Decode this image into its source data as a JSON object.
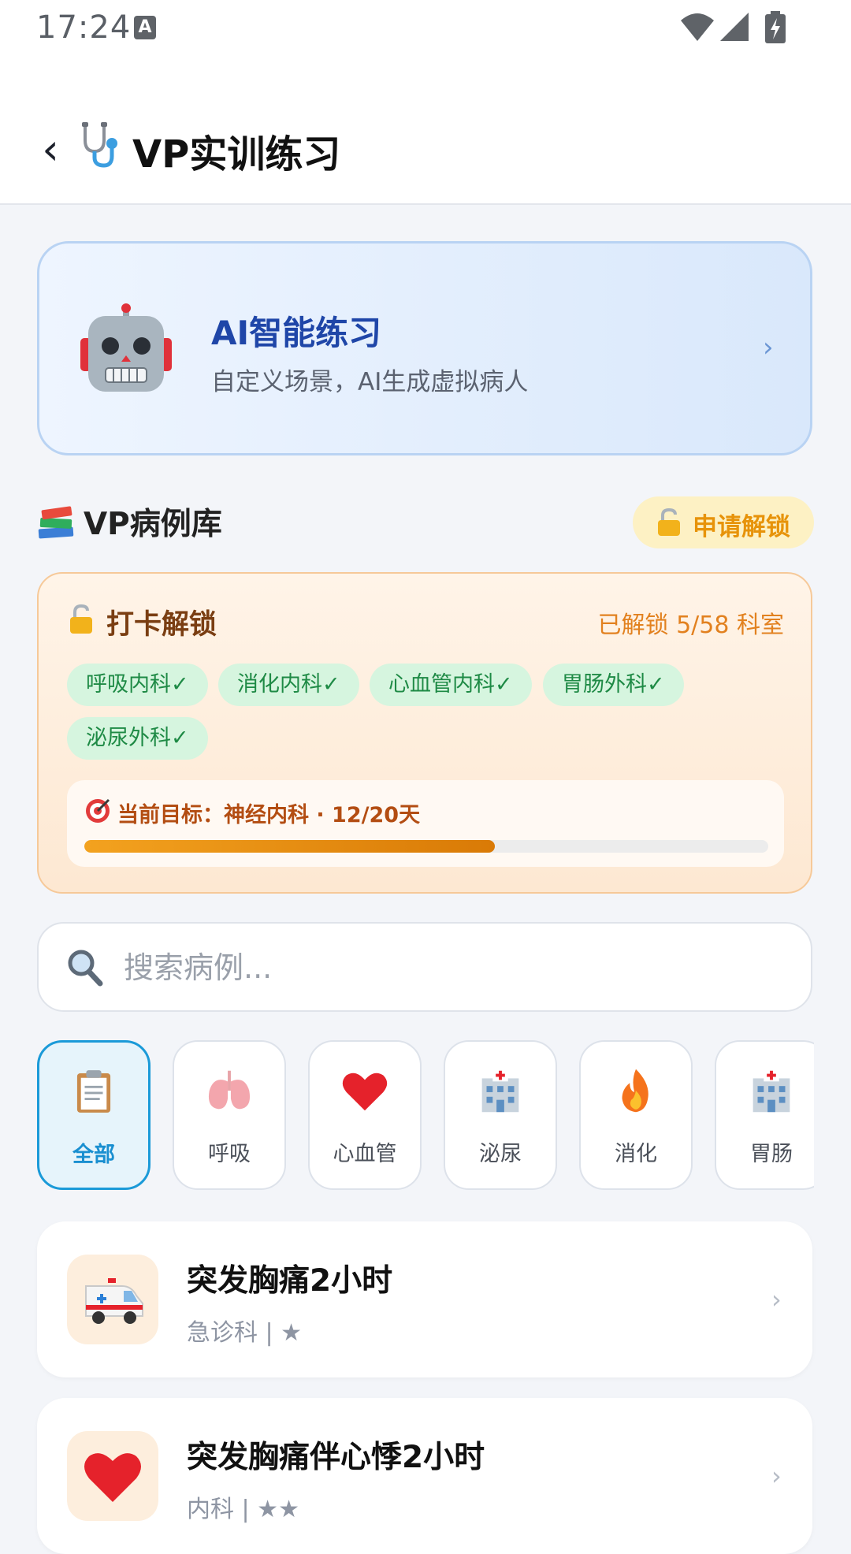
{
  "status_bar": {
    "time": "17:24",
    "notification_icon_label": "A"
  },
  "header": {
    "back_label": "‹",
    "title": "VP实训练习",
    "title_icon": "stethoscope-icon"
  },
  "ai_card": {
    "title": "AI智能练习",
    "subtitle": "自定义场景，AI生成虚拟病人",
    "icon": "robot-icon",
    "chevron": "›"
  },
  "library": {
    "title": "VP病例库",
    "icon": "books-icon",
    "unlock_request_label": "申请解锁"
  },
  "checkin": {
    "title": "打卡解锁",
    "unlocked_status": "已解锁 5/58 科室",
    "unlocked_departments": [
      "呼吸内科✓",
      "消化内科✓",
      "心血管内科✓",
      "胃肠外科✓",
      "泌尿外科✓"
    ],
    "goal_text": "当前目标：神经内科 · 12/20天",
    "goal_progress": 0.6,
    "colors": {
      "progress_start": "#f3a21f",
      "progress_end": "#d97a06",
      "chip_bg": "#d6f5df",
      "chip_text": "#1e8a45"
    }
  },
  "search": {
    "placeholder": "搜索病例..."
  },
  "categories": [
    {
      "label": "全部",
      "icon": "clipboard-icon",
      "active": true
    },
    {
      "label": "呼吸",
      "icon": "lungs-icon",
      "active": false
    },
    {
      "label": "心血管",
      "icon": "heart-icon",
      "active": false
    },
    {
      "label": "泌尿",
      "icon": "hospital-icon",
      "active": false
    },
    {
      "label": "消化",
      "icon": "fire-icon",
      "active": false
    },
    {
      "label": "胃肠",
      "icon": "hospital-icon",
      "active": false
    }
  ],
  "cases": [
    {
      "title": "突发胸痛2小时",
      "meta": "急诊科 | ★",
      "icon": "ambulance-icon",
      "chevron": "›"
    },
    {
      "title": "突发胸痛伴心悸2小时",
      "meta": "内科 | ★★",
      "icon": "heart-icon",
      "chevron": "›"
    }
  ],
  "theme": {
    "accent": "#1a9ad8",
    "ai_title": "#1f46a8",
    "unlock_text": "#e7930a"
  }
}
